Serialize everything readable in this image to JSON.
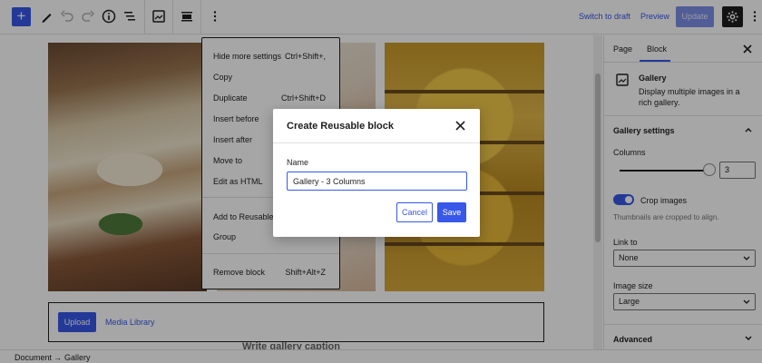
{
  "toolbar": {
    "switch_draft": "Switch to draft",
    "preview": "Preview",
    "update": "Update"
  },
  "canvas": {
    "upload": "Upload",
    "media_library": "Media Library",
    "caption_placeholder": "Write gallery caption"
  },
  "context_menu": {
    "items": [
      {
        "label": "Hide more settings",
        "shortcut": "Ctrl+Shift+,"
      },
      {
        "label": "Copy",
        "shortcut": ""
      },
      {
        "label": "Duplicate",
        "shortcut": "Ctrl+Shift+D"
      },
      {
        "label": "Insert before",
        "shortcut": ""
      },
      {
        "label": "Insert after",
        "shortcut": ""
      },
      {
        "label": "Move to",
        "shortcut": ""
      },
      {
        "label": "Edit as HTML",
        "shortcut": ""
      },
      {
        "label": "Add to Reusable b",
        "shortcut": ""
      },
      {
        "label": "Group",
        "shortcut": ""
      },
      {
        "label": "Remove block",
        "shortcut": "Shift+Alt+Z"
      }
    ]
  },
  "modal": {
    "title": "Create Reusable block",
    "name_label": "Name",
    "name_value": "Gallery - 3 Columns",
    "cancel": "Cancel",
    "save": "Save"
  },
  "sidebar": {
    "tab_page": "Page",
    "tab_block": "Block",
    "block_title": "Gallery",
    "block_desc": "Display multiple images in a rich gallery.",
    "gallery_settings": "Gallery settings",
    "columns_label": "Columns",
    "columns_value": "3",
    "crop_label": "Crop images",
    "crop_enabled": true,
    "crop_help": "Thumbnails are cropped to align.",
    "link_to_label": "Link to",
    "link_to_value": "None",
    "image_size_label": "Image size",
    "image_size_value": "Large",
    "advanced": "Advanced"
  },
  "footer": {
    "crumb1": "Document",
    "arrow": "→",
    "crumb2": "Gallery"
  },
  "colors": {
    "accent": "#3858e9",
    "text": "#1e1e1e"
  }
}
